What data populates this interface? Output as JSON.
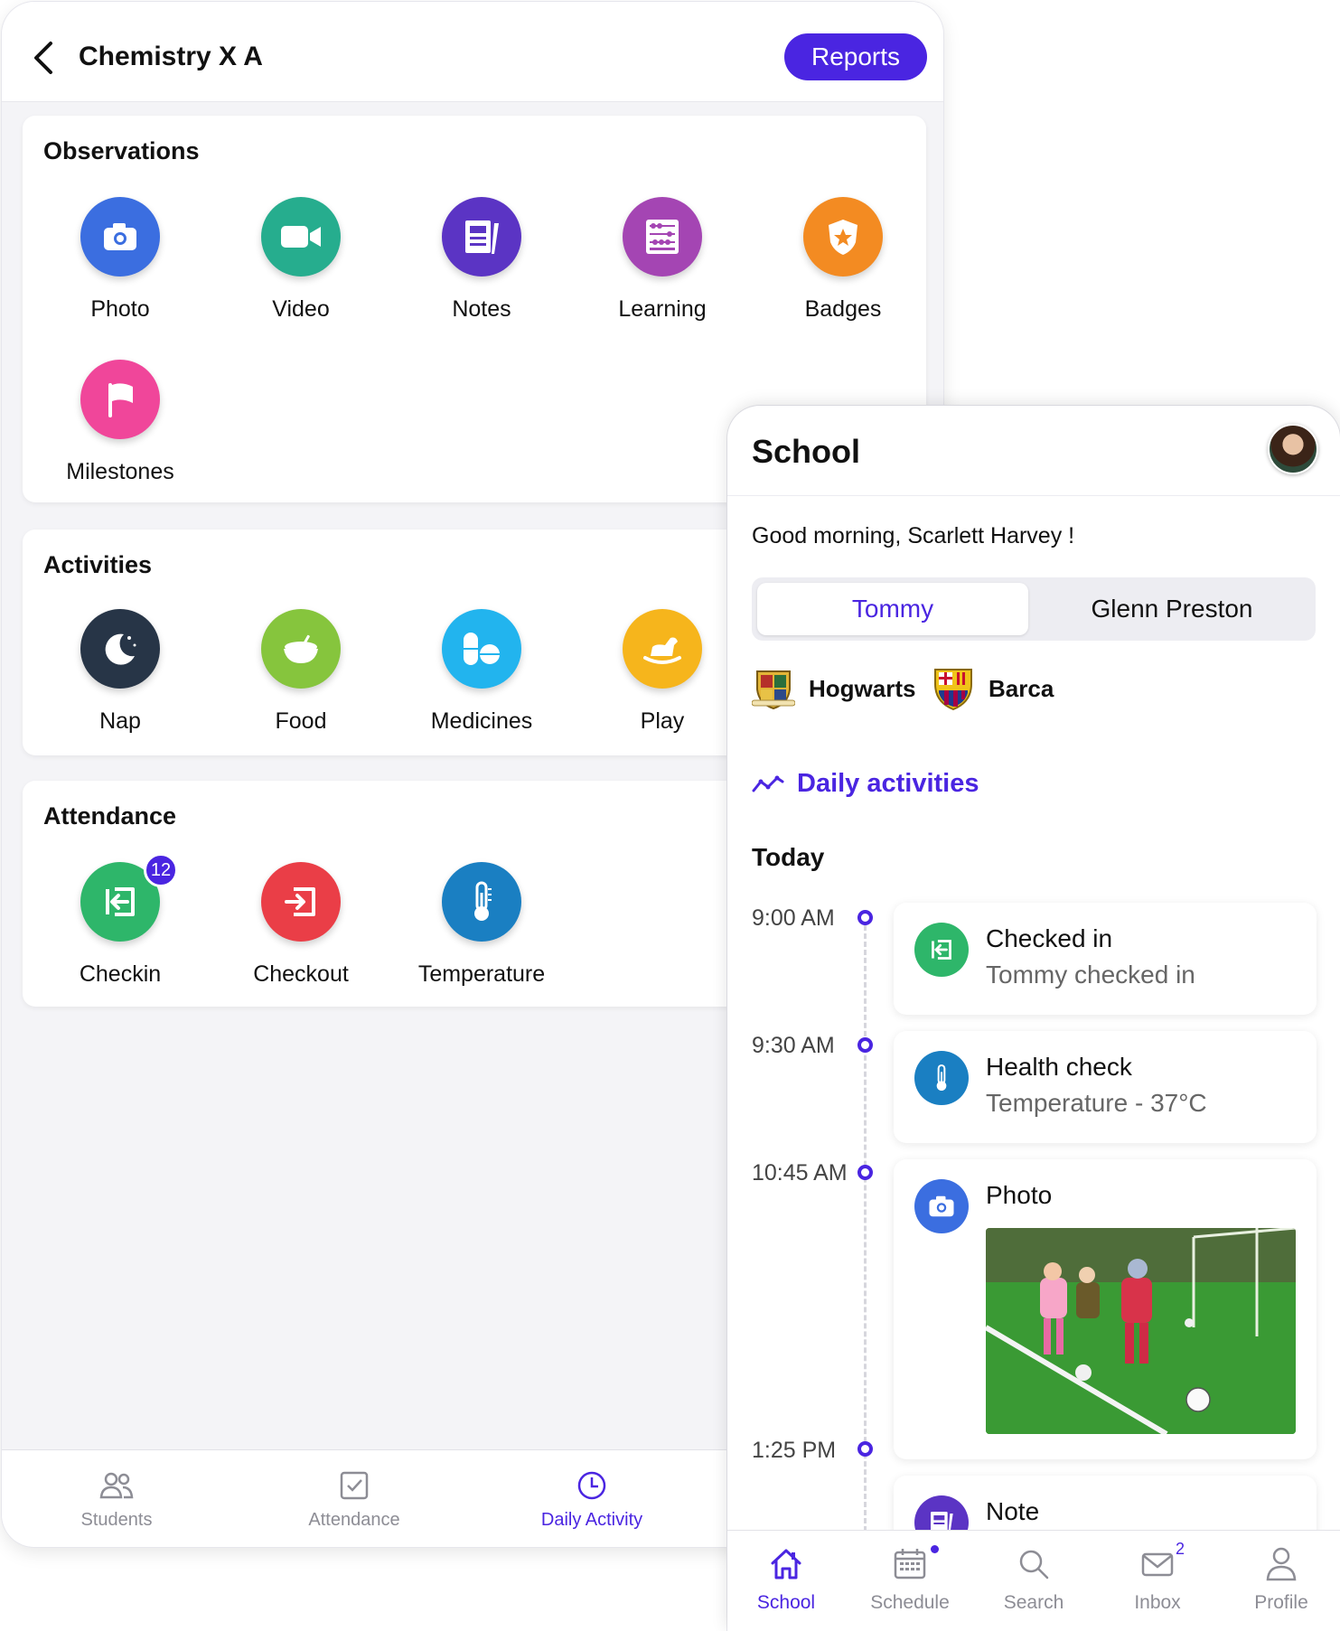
{
  "teacher_app": {
    "header": {
      "title": "Chemistry X A",
      "reports_label": "Reports"
    },
    "observations": {
      "title": "Observations",
      "items": [
        {
          "label": "Photo",
          "icon": "camera-icon",
          "color": "#3b6ee0"
        },
        {
          "label": "Video",
          "icon": "video-icon",
          "color": "#26ad8e"
        },
        {
          "label": "Notes",
          "icon": "notes-icon",
          "color": "#5b34c4"
        },
        {
          "label": "Learning",
          "icon": "abacus-icon",
          "color": "#a445b3"
        },
        {
          "label": "Badges",
          "icon": "badge-icon",
          "color": "#f38b22"
        },
        {
          "label": "Milestones",
          "icon": "flag-icon",
          "color": "#f0469a"
        }
      ]
    },
    "activities": {
      "title": "Activities",
      "items": [
        {
          "label": "Nap",
          "icon": "moon-icon",
          "color": "#273547"
        },
        {
          "label": "Food",
          "icon": "bowl-icon",
          "color": "#86c53d"
        },
        {
          "label": "Medicines",
          "icon": "pill-icon",
          "color": "#22b4ee"
        },
        {
          "label": "Play",
          "icon": "rocking-horse-icon",
          "color": "#f6b51c"
        }
      ]
    },
    "attendance": {
      "title": "Attendance",
      "items": [
        {
          "label": "Checkin",
          "icon": "checkin-icon",
          "color": "#2eb66a",
          "badge": "12"
        },
        {
          "label": "Checkout",
          "icon": "checkout-icon",
          "color": "#ea3e47"
        },
        {
          "label": "Temperature",
          "icon": "thermometer-icon",
          "color": "#1a7fc2"
        }
      ]
    },
    "tabbar": {
      "students": "Students",
      "attendance": "Attendance",
      "daily_activity": "Daily Activity"
    }
  },
  "parent_app": {
    "header": {
      "title": "School"
    },
    "greeting": "Good morning, Scarlett Harvey !",
    "children": {
      "selected": "Tommy",
      "other": "Glenn Preston"
    },
    "schools": [
      "Hogwarts",
      "Barca"
    ],
    "daily_activities_label": "Daily activities",
    "today_label": "Today",
    "timeline": [
      {
        "time": "9:00 AM",
        "title": "Checked in",
        "subtitle": "Tommy checked in",
        "icon": "checkin-icon",
        "color": "#2eb66a"
      },
      {
        "time": "9:30 AM",
        "title": "Health check",
        "subtitle": "Temperature - 37°C",
        "icon": "thermometer-icon",
        "color": "#1a7fc2"
      },
      {
        "time": "10:45 AM",
        "title": "Photo",
        "icon": "camera-icon",
        "color": "#3b6ee0"
      },
      {
        "time": "1:25 PM",
        "title": "Note",
        "icon": "notes-icon",
        "color": "#5b34c4"
      }
    ],
    "tabbar": {
      "school": "School",
      "schedule": "Schedule",
      "search": "Search",
      "inbox": "Inbox",
      "inbox_count": "2",
      "profile": "Profile"
    },
    "accent": "#4a25e1"
  }
}
